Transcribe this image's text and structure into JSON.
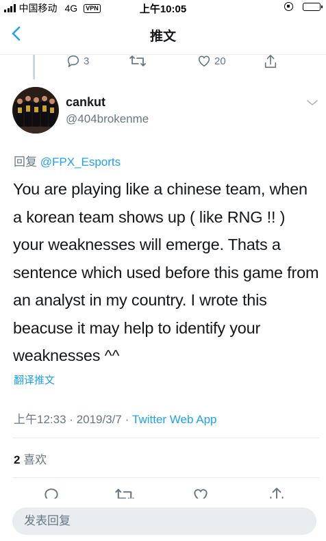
{
  "status_bar": {
    "carrier": "中国移动",
    "network": "4G",
    "vpn": "VPN",
    "time": "上午10:05"
  },
  "nav": {
    "title": "推文"
  },
  "previous_tweet": {
    "reply_count": "3",
    "like_count": "20"
  },
  "tweet": {
    "display_name": "cankut",
    "handle": "@404brokenme",
    "reply_prefix": "回复",
    "reply_to": "@FPX_Esports",
    "text": "You are playing like a chinese team, when a korean team  shows up ( like RNG !! ) your weaknesses will emerge. Thats a sentence which used before this game from an analyst in my country. I wrote this beacuse it may help to identify your weaknesses ^^",
    "translate_label": "翻译推文",
    "time": "上午12:33",
    "date": "2019/3/7",
    "source": "Twitter Web App",
    "separator": "·"
  },
  "stats": {
    "likes_count": "2",
    "likes_label": "喜欢"
  },
  "composer": {
    "placeholder": "发表回复"
  },
  "colors": {
    "accent": "#1da1f2",
    "muted": "#657786",
    "divider": "#e6ecf0"
  },
  "icons": [
    "back-icon",
    "reply-icon",
    "retweet-icon",
    "like-icon",
    "share-icon",
    "chevron-down-icon",
    "lock-rotation-icon",
    "battery-icon",
    "signal-icon"
  ]
}
